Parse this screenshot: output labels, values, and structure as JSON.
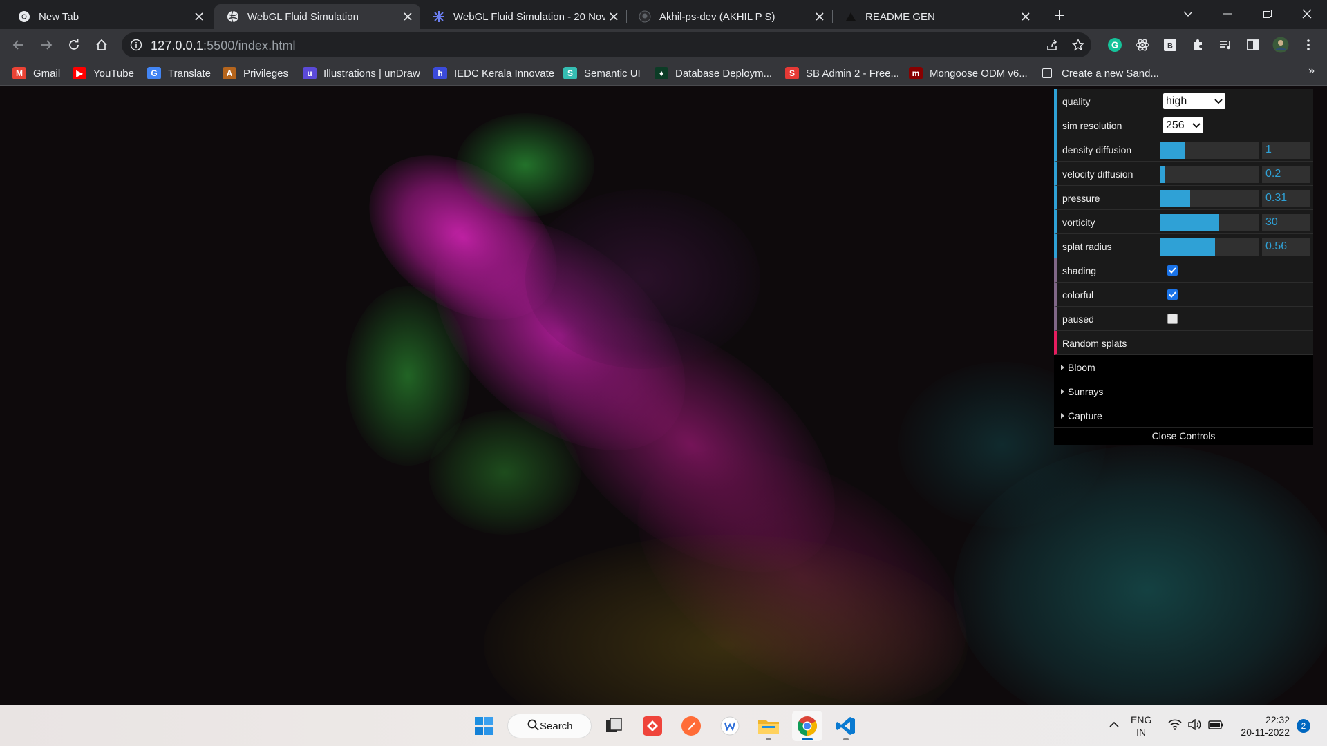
{
  "browser": {
    "tabs": [
      {
        "label": "New Tab",
        "icon": "chrome-icon"
      },
      {
        "label": "WebGL Fluid Simulation",
        "icon": "globe-icon"
      },
      {
        "label": "WebGL Fluid Simulation - 20 Nov",
        "icon": "dots-icon"
      },
      {
        "label": "Akhil-ps-dev (AKHIL P S)",
        "icon": "github-icon"
      },
      {
        "label": "README GEN",
        "icon": "triangle-icon"
      }
    ],
    "active_tab": 1,
    "url_host": "127.0.0.1",
    "url_path": ":5500/index.html"
  },
  "bookmarks": [
    {
      "label": "Gmail",
      "icon": "gmail-icon",
      "color": "#ea4335",
      "glyph": "M"
    },
    {
      "label": "YouTube",
      "icon": "youtube-icon",
      "color": "#ff0000",
      "glyph": "▶"
    },
    {
      "label": "Translate",
      "icon": "translate-icon",
      "color": "#4285f4",
      "glyph": "G"
    },
    {
      "label": "Privileges",
      "icon": "privileges-icon",
      "color": "#b5651d",
      "glyph": "A"
    },
    {
      "label": "Illustrations | unDraw",
      "icon": "undraw-icon",
      "color": "#5b4ad8",
      "glyph": "u"
    },
    {
      "label": "IEDC Kerala Innovate",
      "icon": "iedc-icon",
      "color": "#3b4bdb",
      "glyph": "h"
    },
    {
      "label": "Semantic UI",
      "icon": "semantic-ui-icon",
      "color": "#35bdb2",
      "glyph": "S"
    },
    {
      "label": "Database Deploym...",
      "icon": "mongodb-leaf-icon",
      "color": "#0c3c26",
      "glyph": "♦"
    },
    {
      "label": "SB Admin 2 - Free...",
      "icon": "sb-admin-icon",
      "color": "#e53935",
      "glyph": "S"
    },
    {
      "label": "Mongoose ODM v6...",
      "icon": "mongoose-icon",
      "color": "#880000",
      "glyph": "m"
    },
    {
      "label": "Create a new Sand...",
      "icon": "page-icon",
      "color": "#202124",
      "glyph": ""
    }
  ],
  "gui": {
    "quality": {
      "label": "quality",
      "value": "high"
    },
    "sim_resolution": {
      "label": "sim resolution",
      "value": "256"
    },
    "sliders": [
      {
        "label": "density diffusion",
        "value": "1",
        "fraction": 0.25
      },
      {
        "label": "velocity diffusion",
        "value": "0.2",
        "fraction": 0.05
      },
      {
        "label": "pressure",
        "value": "0.31",
        "fraction": 0.31
      },
      {
        "label": "vorticity",
        "value": "30",
        "fraction": 0.6
      },
      {
        "label": "splat radius",
        "value": "0.56",
        "fraction": 0.56
      }
    ],
    "checks": [
      {
        "label": "shading",
        "checked": true
      },
      {
        "label": "colorful",
        "checked": true
      },
      {
        "label": "paused",
        "checked": false
      }
    ],
    "random_splats": "Random splats",
    "folders": [
      "Bloom",
      "Sunrays",
      "Capture"
    ],
    "close": "Close Controls"
  },
  "taskbar": {
    "search": "Search",
    "lang_line1": "ENG",
    "lang_line2": "IN",
    "time": "22:32",
    "date": "20-11-2022",
    "notifications": "2"
  }
}
